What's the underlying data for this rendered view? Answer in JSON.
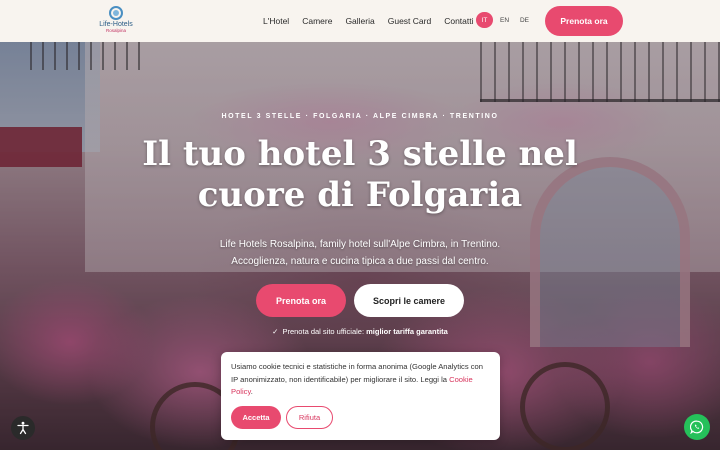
{
  "brand": {
    "name": "Life-Hotels",
    "sub": "Rosalpina"
  },
  "nav": {
    "items": [
      {
        "label": "L'Hotel"
      },
      {
        "label": "Camere"
      },
      {
        "label": "Galleria"
      },
      {
        "label": "Guest Card"
      },
      {
        "label": "Contatti"
      }
    ],
    "languages": [
      {
        "label": "IT",
        "active": true
      },
      {
        "label": "EN",
        "active": false
      },
      {
        "label": "DE",
        "active": false
      }
    ],
    "book_label": "Prenota ora"
  },
  "hero": {
    "kicker": "HOTEL 3 STELLE · FOLGARIA · ALPE CIMBRA · TRENTINO",
    "title_line1": "Il tuo hotel 3 stelle nel",
    "title_line2": "cuore di Folgaria",
    "subtitle_line1": "Life Hotels Rosalpina, family hotel sull'Alpe Cimbra, in Trentino.",
    "subtitle_line2": "Accoglienza, natura e cucina tipica a due passi dal centro.",
    "cta_primary": "Prenota ora",
    "cta_secondary": "Scopri le camere",
    "guarantee_text": "Prenota dal sito ufficiale: ",
    "guarantee_bold": "miglior tariffa garantita"
  },
  "cookie": {
    "text": "Usiamo cookie tecnici e statistiche in forma anonima (Google Analytics con IP anonimizzato, non identificabile) per migliorare il sito. Leggi la ",
    "link": "Cookie Policy",
    "link_suffix": ".",
    "accept": "Accetta",
    "reject": "Rifiuta"
  },
  "colors": {
    "accent": "#e84a6f",
    "header_bg": "#f8f4ef",
    "whatsapp": "#25c05a"
  },
  "icons": {
    "accessibility": "accessibility-icon",
    "whatsapp": "whatsapp-icon",
    "check": "check-icon"
  }
}
